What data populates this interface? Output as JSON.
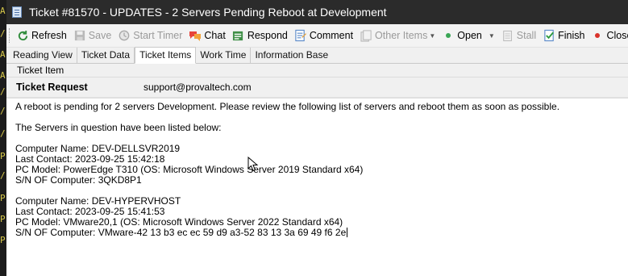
{
  "window": {
    "title": "Ticket #81570 - UPDATES - 2 Servers Pending Reboot at Development"
  },
  "left_strip_glyphs": [
    "A",
    "/",
    "A",
    "A",
    "/",
    "/",
    "/",
    "P",
    "/",
    "P",
    "P",
    "P"
  ],
  "toolbar": {
    "items": [
      {
        "label": "Refresh",
        "icon": "refresh-icon",
        "enabled": true
      },
      {
        "label": "Save",
        "icon": "save-icon",
        "enabled": false
      },
      {
        "label": "Start Timer",
        "icon": "timer-icon",
        "enabled": false
      },
      {
        "label": "Chat",
        "icon": "chat-icon",
        "enabled": true
      },
      {
        "label": "Respond",
        "icon": "respond-icon",
        "enabled": true
      },
      {
        "label": "Comment",
        "icon": "comment-icon",
        "enabled": true
      },
      {
        "label": "Other Items",
        "icon": "other-items-icon",
        "enabled": false
      },
      {
        "label": "Open",
        "icon": "open-status-icon",
        "enabled": true
      },
      {
        "label": "Stall",
        "icon": "stall-icon",
        "enabled": false
      },
      {
        "label": "Finish",
        "icon": "finish-icon",
        "enabled": true
      },
      {
        "label": "Close",
        "icon": "close-icon",
        "enabled": true
      }
    ]
  },
  "tabs": [
    {
      "label": "Reading View",
      "active": false
    },
    {
      "label": "Ticket Data",
      "active": false
    },
    {
      "label": "Ticket Items",
      "active": true
    },
    {
      "label": "Work Time",
      "active": false
    },
    {
      "label": "Information Base",
      "active": false
    }
  ],
  "group_label": "Ticket Item",
  "request": {
    "title": "Ticket Request",
    "email": "support@provaltech.com"
  },
  "body_lines": [
    "A reboot is pending for 2 servers Development. Please review the following list of servers and reboot them as soon as possible.",
    "",
    "The Servers in question have been listed below:",
    "",
    "Computer Name: DEV-DELLSVR2019",
    "Last Contact: 2023-09-25 15:42:18",
    "PC Model: PowerEdge T310 (OS: Microsoft Windows Server 2019 Standard x64)",
    "S/N OF Computer: 3QKD8P1",
    "",
    "Computer Name: DEV-HYPERVHOST",
    "Last Contact: 2023-09-25 15:41:53",
    "PC Model: VMware20,1 (OS: Microsoft Windows Server 2022 Standard x64)",
    "S/N OF Computer: VMware-42 13 b3 ec ec 59 d9 a3-52 83 13 3a 69 49 f6 2e"
  ],
  "colors": {
    "titlebar_bg": "#2b2b2b",
    "toolbar_bg": "#f3f3f3",
    "content_bg": "#ffffff",
    "strip_glyph": "#d8c94a"
  }
}
